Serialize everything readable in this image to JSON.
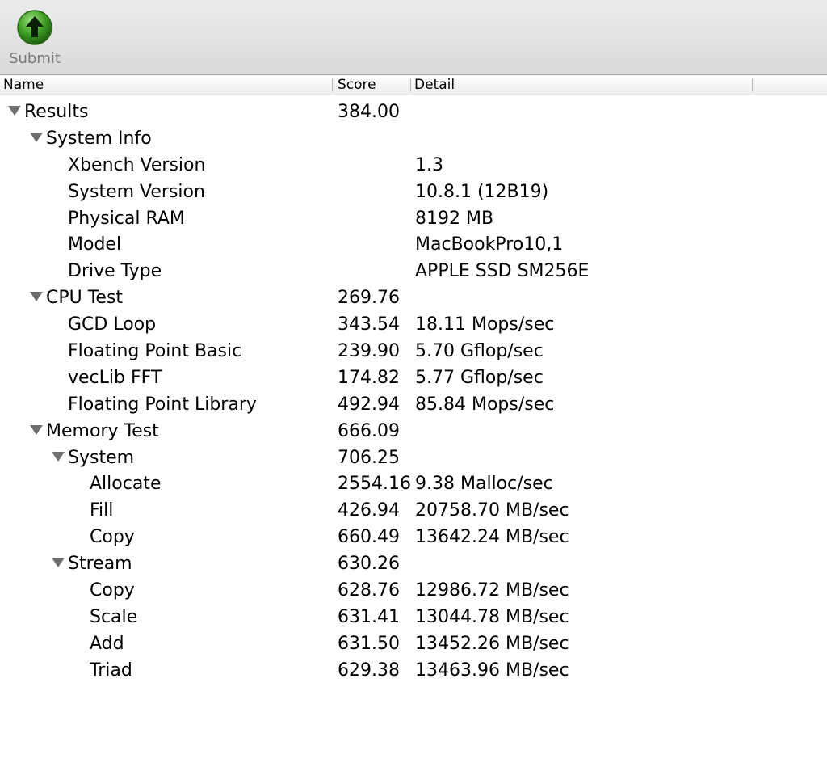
{
  "toolbar": {
    "submit_label": "Submit",
    "submit_icon": "green-up-arrow-icon"
  },
  "columns": {
    "name": "Name",
    "score": "Score",
    "detail": "Detail"
  },
  "rows": [
    {
      "name": "Results",
      "score": "384.00",
      "detail": "",
      "level": 0,
      "expanded": true
    },
    {
      "name": "System Info",
      "score": "",
      "detail": "",
      "level": 1,
      "expanded": true
    },
    {
      "name": "Xbench Version",
      "score": "",
      "detail": "1.3",
      "level": 2
    },
    {
      "name": "System Version",
      "score": "",
      "detail": "10.8.1 (12B19)",
      "level": 2
    },
    {
      "name": "Physical RAM",
      "score": "",
      "detail": "8192 MB",
      "level": 2
    },
    {
      "name": "Model",
      "score": "",
      "detail": "MacBookPro10,1",
      "level": 2
    },
    {
      "name": "Drive Type",
      "score": "",
      "detail": "APPLE SSD SM256E",
      "level": 2
    },
    {
      "name": "CPU Test",
      "score": "269.76",
      "detail": "",
      "level": 1,
      "expanded": true
    },
    {
      "name": "GCD Loop",
      "score": "343.54",
      "detail": "18.11 Mops/sec",
      "level": 2
    },
    {
      "name": "Floating Point Basic",
      "score": "239.90",
      "detail": "5.70 Gflop/sec",
      "level": 2
    },
    {
      "name": "vecLib FFT",
      "score": "174.82",
      "detail": "5.77 Gflop/sec",
      "level": 2
    },
    {
      "name": "Floating Point Library",
      "score": "492.94",
      "detail": "85.84 Mops/sec",
      "level": 2
    },
    {
      "name": "Memory Test",
      "score": "666.09",
      "detail": "",
      "level": 1,
      "expanded": true
    },
    {
      "name": "System",
      "score": "706.25",
      "detail": "",
      "level": 2,
      "expanded": true
    },
    {
      "name": "Allocate",
      "score": "2554.16",
      "detail": "9.38 Malloc/sec",
      "level": 3
    },
    {
      "name": "Fill",
      "score": "426.94",
      "detail": "20758.70 MB/sec",
      "level": 3
    },
    {
      "name": "Copy",
      "score": "660.49",
      "detail": "13642.24 MB/sec",
      "level": 3
    },
    {
      "name": "Stream",
      "score": "630.26",
      "detail": "",
      "level": 2,
      "expanded": true
    },
    {
      "name": "Copy",
      "score": "628.76",
      "detail": "12986.72 MB/sec",
      "level": 3
    },
    {
      "name": "Scale",
      "score": "631.41",
      "detail": "13044.78 MB/sec",
      "level": 3
    },
    {
      "name": "Add",
      "score": "631.50",
      "detail": "13452.26 MB/sec",
      "level": 3
    },
    {
      "name": "Triad",
      "score": "629.38",
      "detail": "13463.96 MB/sec",
      "level": 3
    }
  ]
}
